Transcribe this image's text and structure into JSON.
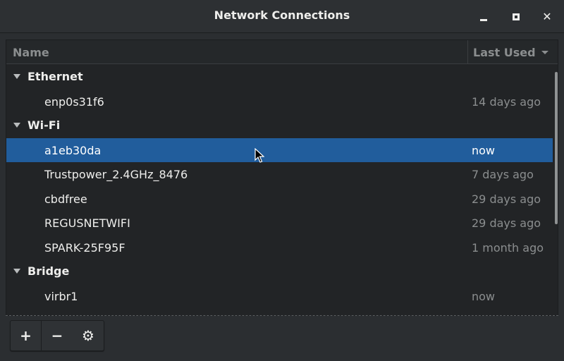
{
  "window": {
    "title": "Network Connections",
    "controls": {
      "minimize": "minimize-icon",
      "maximize": "maximize-icon",
      "close": "close-icon",
      "close_glyph": "✕"
    }
  },
  "table": {
    "columns": {
      "name": "Name",
      "last_used": "Last Used"
    },
    "sort": {
      "column": "Last Used",
      "direction": "descending"
    },
    "groups": [
      {
        "label": "Ethernet",
        "items": [
          {
            "name": "enp0s31f6",
            "last_used": "14 days ago"
          }
        ]
      },
      {
        "label": "Wi-Fi",
        "items": [
          {
            "name": "a1eb30da",
            "last_used": "now",
            "selected": true
          },
          {
            "name": "Trustpower_2.4GHz_8476",
            "last_used": "7 days ago"
          },
          {
            "name": "cbdfree",
            "last_used": "29 days ago"
          },
          {
            "name": "REGUSNETWIFI",
            "last_used": "29 days ago"
          },
          {
            "name": "SPARK-25F95F",
            "last_used": "1 month ago"
          }
        ]
      },
      {
        "label": "Bridge",
        "items": [
          {
            "name": "virbr1",
            "last_used": "now"
          }
        ]
      }
    ]
  },
  "toolbar": {
    "add_label": "+",
    "remove_label": "−",
    "settings_label": "⚙"
  },
  "colors": {
    "selection": "#215d9c",
    "background": "#2b2e31",
    "list_background": "#222426"
  }
}
